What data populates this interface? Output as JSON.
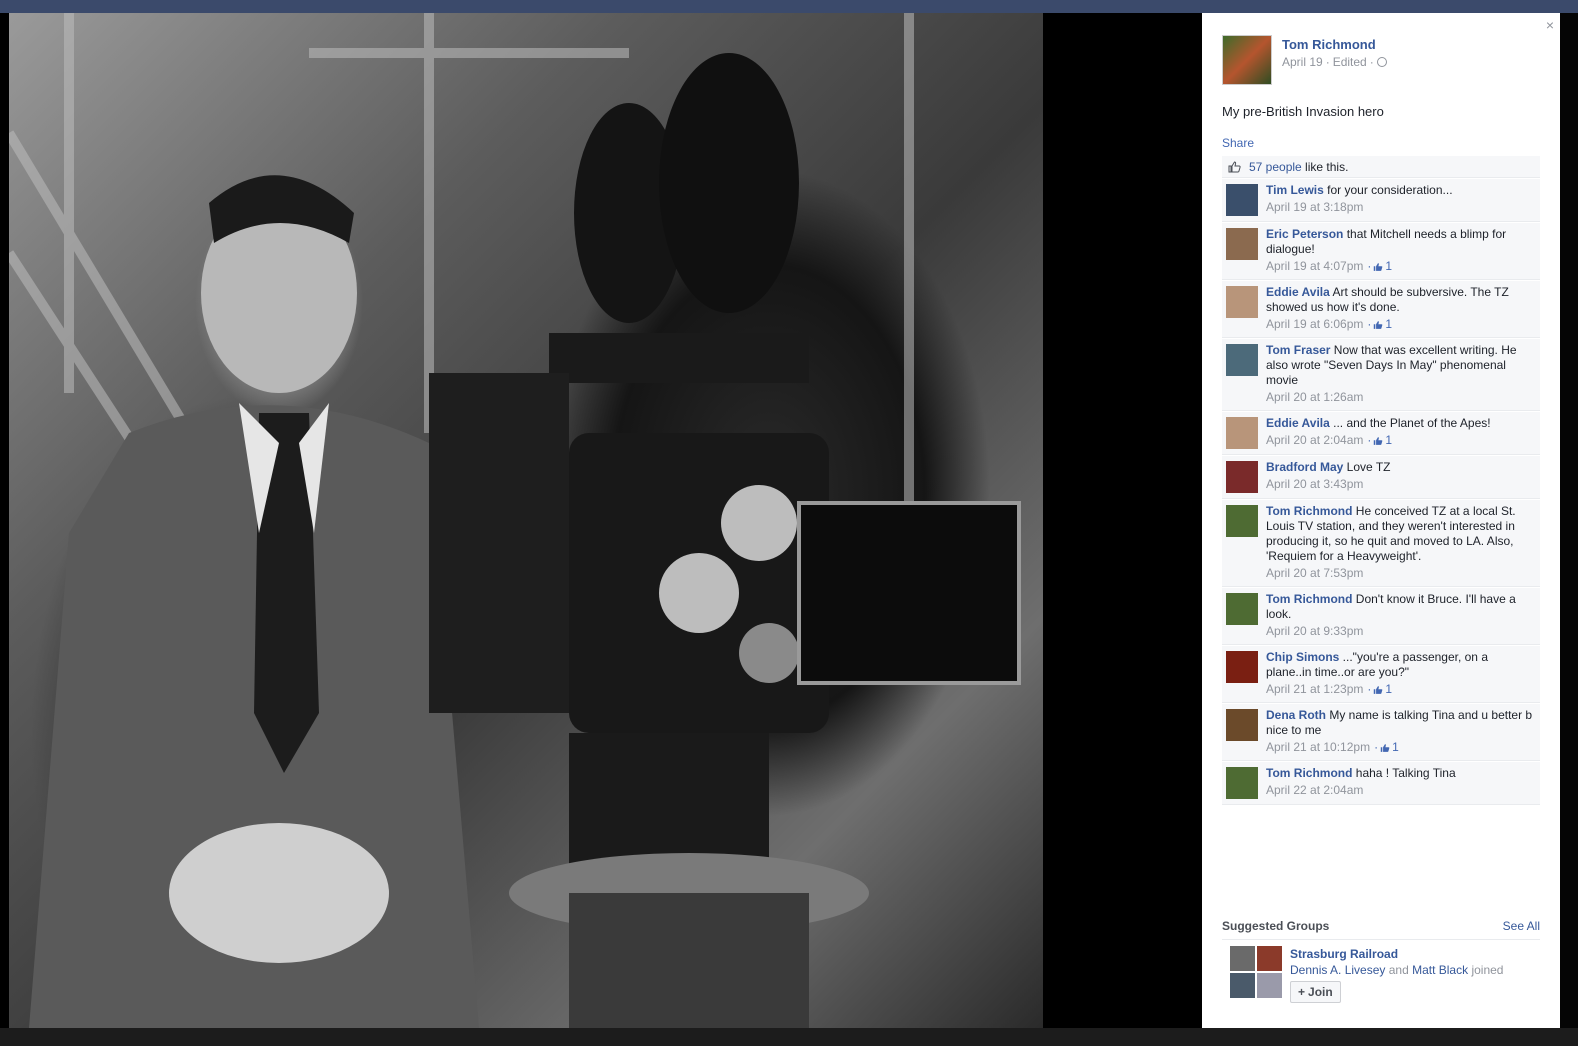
{
  "post": {
    "author": "Tom Richmond",
    "date": "April 19",
    "edited": "Edited",
    "separator": "·",
    "caption": "My pre-British Invasion hero",
    "share_label": "Share",
    "likes_link": "57 people",
    "likes_suffix": " like this.",
    "close_glyph": "×"
  },
  "comments": [
    {
      "name": "Tim Lewis",
      "text": " for your consideration...",
      "time": "April 19 at 3:18pm",
      "likes": "",
      "avatar": "#3a4f6b"
    },
    {
      "name": "Eric Peterson",
      "text": " that Mitchell needs a blimp for dialogue!",
      "time": "April 19 at 4:07pm",
      "likes": "1",
      "avatar": "#8b6a4f"
    },
    {
      "name": "Eddie Avila",
      "text": " Art should be subversive. The TZ showed us how it's done.",
      "time": "April 19 at 6:06pm",
      "likes": "1",
      "avatar": "#b8957a"
    },
    {
      "name": "Tom Fraser",
      "text": " Now that was excellent writing. He also wrote \"Seven Days In May\" phenomenal movie",
      "time": "April 20 at 1:26am",
      "likes": "",
      "avatar": "#4c6a7a"
    },
    {
      "name": "Eddie Avila",
      "text": " ... and the Planet of the Apes!",
      "time": "April 20 at 2:04am",
      "likes": "1",
      "avatar": "#b8957a"
    },
    {
      "name": "Bradford May",
      "text": " Love TZ",
      "time": "April 20 at 3:43pm",
      "likes": "",
      "avatar": "#7a2a2a"
    },
    {
      "name": "Tom Richmond",
      "text": " He conceived TZ at a local St. Louis TV station, and they weren't interested in producing it, so he quit and moved to LA. Also, 'Requiem for a Heavyweight'.",
      "time": "April 20 at 7:53pm",
      "likes": "",
      "avatar": "#4e6b33"
    },
    {
      "name": "Tom Richmond",
      "text": " Don't know it Bruce. I'll have a look.",
      "time": "April 20 at 9:33pm",
      "likes": "",
      "avatar": "#4e6b33"
    },
    {
      "name": "Chip Simons",
      "text": " ...\"you're a passenger, on a plane..in time..or are you?\"",
      "time": "April 21 at 1:23pm",
      "likes": "1",
      "avatar": "#7a1f12"
    },
    {
      "name": "Dena Roth",
      "text": " My name is talking Tina and u better b nice to me",
      "time": "April 21 at 10:12pm",
      "likes": "1",
      "avatar": "#6b4a2a"
    },
    {
      "name": "Tom Richmond",
      "text": " haha ! Talking Tina",
      "time": "April 22 at 2:04am",
      "likes": "",
      "avatar": "#4e6b33"
    }
  ],
  "suggested": {
    "title": "Suggested Groups",
    "see_all": "See All",
    "group_name": "Strasburg Railroad",
    "member1": "Dennis A. Livesey",
    "and": " and ",
    "member2": "Matt Black",
    "joined": " joined",
    "join_label": "Join",
    "join_plus": "+"
  },
  "colors": {
    "link": "#365899",
    "meta": "#90949c",
    "comment_bg": "#f6f7f9"
  }
}
